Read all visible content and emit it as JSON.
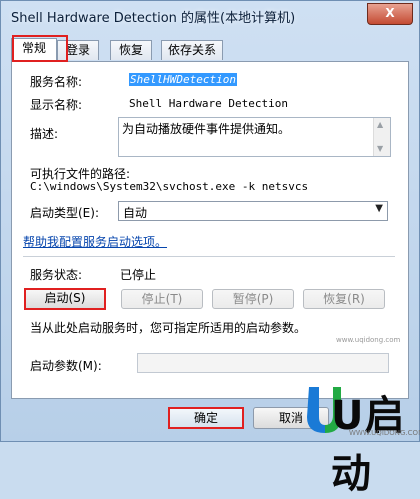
{
  "window": {
    "title": "Shell Hardware Detection 的属性(本地计算机)",
    "close_label": "X"
  },
  "tabs": [
    {
      "label": "常规",
      "active": true
    },
    {
      "label": "登录",
      "active": false
    },
    {
      "label": "恢复",
      "active": false
    },
    {
      "label": "依存关系",
      "active": false
    }
  ],
  "general": {
    "service_name_label": "服务名称:",
    "service_name_value": "ShellHWDetection",
    "display_name_label": "显示名称:",
    "display_name_value": "Shell Hardware Detection",
    "description_label": "描述:",
    "description_value": "为自动播放硬件事件提供通知。",
    "exe_path_label": "可执行文件的路径:",
    "exe_path_value": "C:\\windows\\System32\\svchost.exe -k netsvcs",
    "startup_type_label": "启动类型(E):",
    "startup_type_value": "自动",
    "help_link": "帮助我配置服务启动选项。",
    "status_label": "服务状态:",
    "status_value": "已停止",
    "buttons": {
      "start": "启动(S)",
      "stop": "停止(T)",
      "pause": "暂停(P)",
      "resume": "恢复(R)"
    },
    "hint": "当从此处启动服务时，您可指定所适用的启动参数。",
    "params_label": "启动参数(M):",
    "params_value": ""
  },
  "footer": {
    "ok_label": "确定",
    "cancel_label": "取消"
  },
  "watermark": {
    "logo_text": "U启动",
    "logo_sub": "WWW.UQIDONG.COM",
    "site": "www.uqidong.com"
  }
}
